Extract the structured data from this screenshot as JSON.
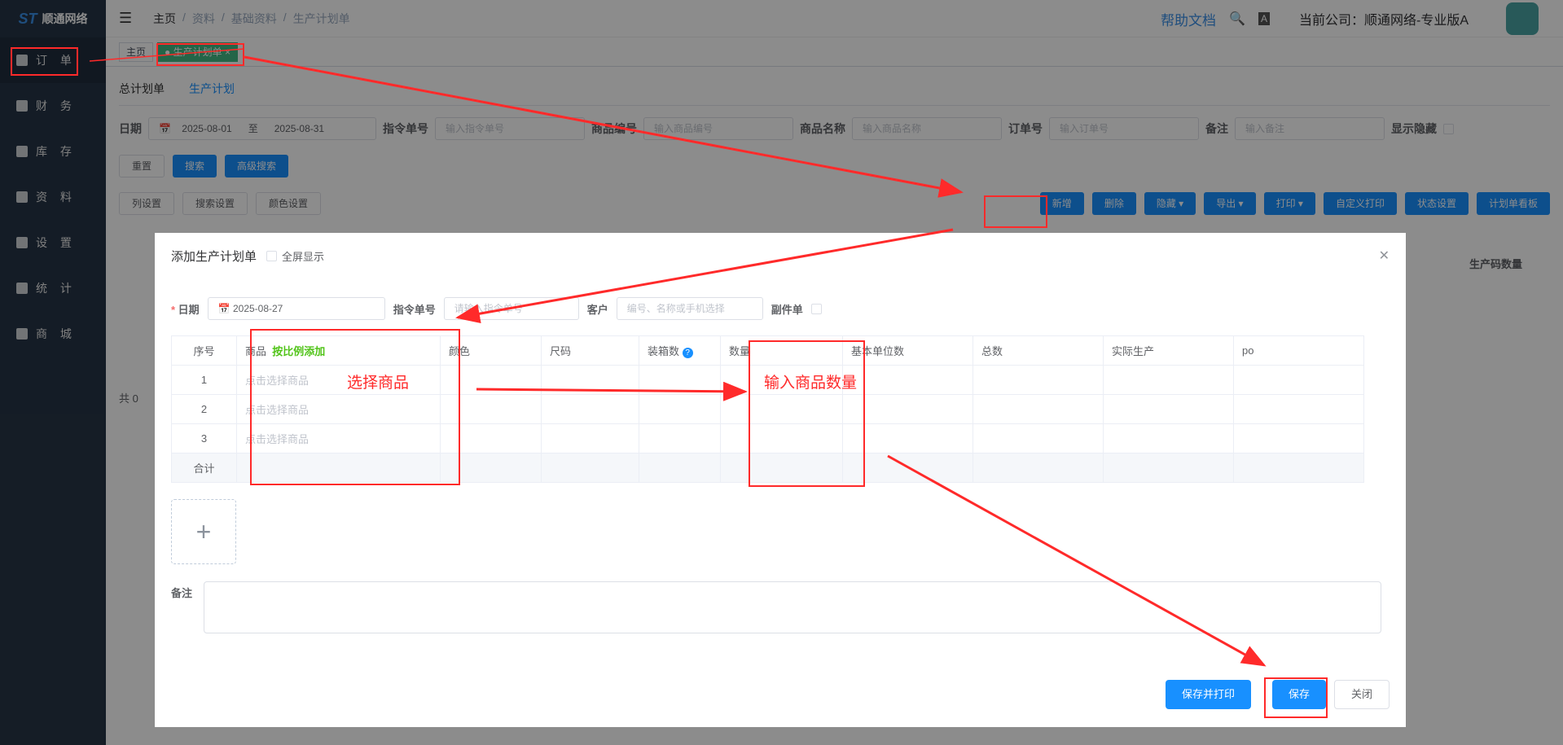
{
  "logo": {
    "text": "顺通网络"
  },
  "sidebar": {
    "items": [
      {
        "label": "订 单"
      },
      {
        "label": "财 务"
      },
      {
        "label": "库 存"
      },
      {
        "label": "资 料"
      },
      {
        "label": "设 置"
      },
      {
        "label": "统 计"
      },
      {
        "label": "商 城"
      }
    ]
  },
  "breadcrumb": [
    "主页",
    "资料",
    "基础资料",
    "生产计划单"
  ],
  "header": {
    "help": "帮助文档",
    "company": "当前公司：顺通网络-专业版A"
  },
  "tags": {
    "home": "主页",
    "active": "生产计划单",
    "close": "×"
  },
  "subtabs": [
    "总计划单",
    "生产计划"
  ],
  "filters": {
    "date_label": "日期",
    "date_from": "2025-08-01",
    "date_sep": "至",
    "date_to": "2025-08-31",
    "order_cmd_label": "指令单号",
    "order_cmd_ph": "输入指令单号",
    "goods_code_label": "商品编号",
    "goods_code_ph": "输入商品编号",
    "goods_name_label": "商品名称",
    "goods_name_ph": "输入商品名称",
    "order_no_label": "订单号",
    "order_no_ph": "输入订单号",
    "remark_label": "备注",
    "remark_ph": "输入备注",
    "show_hidden_label": "显示隐藏"
  },
  "search_buttons": {
    "reset": "重置",
    "search": "搜索",
    "advanced": "高级搜索"
  },
  "settings_buttons": {
    "col": "列设置",
    "search": "搜索设置",
    "color": "颜色设置"
  },
  "actions": {
    "add": "新增",
    "delete": "删除",
    "hide": "隐藏",
    "export": "导出",
    "print": "打印",
    "custom_print": "自定义打印",
    "status": "状态设置",
    "board": "计划单看板"
  },
  "bg_table": {
    "col": "生产码数量",
    "total_prefix": "共 0"
  },
  "dialog": {
    "title": "添加生产计划单",
    "fullscreen": "全屏显示",
    "date_label": "日期",
    "date_value": "2025-08-27",
    "cmd_label": "指令单号",
    "cmd_ph": "请输入指令单号",
    "customer_label": "客户",
    "customer_ph": "编号、名称或手机选择",
    "sub_label": "副件单",
    "columns": [
      "序号",
      "商品",
      "颜色",
      "尺码",
      "装箱数",
      "数量",
      "基本单位数",
      "总数",
      "实际生产",
      "po"
    ],
    "ratio_add": "按比例添加",
    "rows": [
      {
        "no": "1",
        "goods_ph": "点击选择商品"
      },
      {
        "no": "2",
        "goods_ph": "点击选择商品"
      },
      {
        "no": "3",
        "goods_ph": "点击选择商品"
      }
    ],
    "sum_label": "合计",
    "remark_label": "备注",
    "save_print": "保存并打印",
    "save": "保存",
    "close": "关闭"
  },
  "annotations": {
    "select_goods": "选择商品",
    "input_qty": "输入商品数量"
  },
  "colors": {
    "primary": "#1890ff",
    "sidebar": "#263445",
    "annotation": "#ff2a2a",
    "ratio_green": "#52c41a"
  }
}
